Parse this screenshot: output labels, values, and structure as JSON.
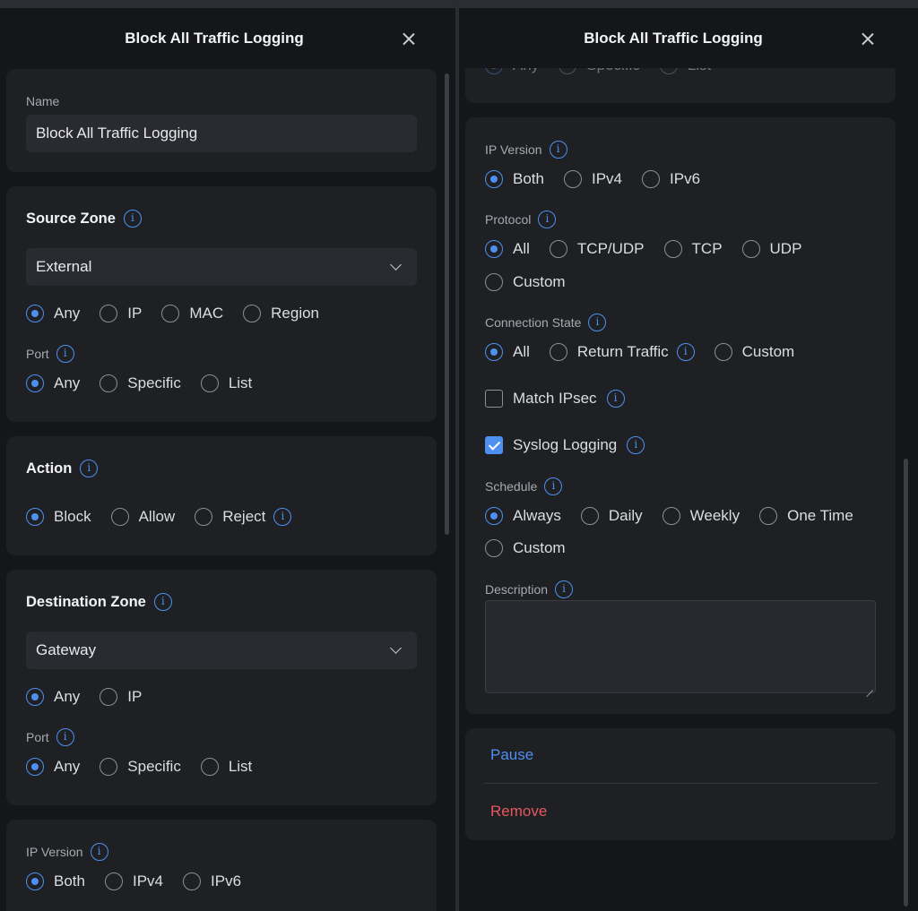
{
  "left": {
    "title": "Block All Traffic Logging",
    "name": {
      "label": "Name",
      "value": "Block All Traffic Logging"
    },
    "source_zone": {
      "title": "Source Zone",
      "selected": "External",
      "addr_options": [
        "Any",
        "IP",
        "MAC",
        "Region"
      ],
      "port_label": "Port",
      "port_options": [
        "Any",
        "Specific",
        "List"
      ]
    },
    "action": {
      "title": "Action",
      "options": [
        "Block",
        "Allow",
        "Reject"
      ]
    },
    "destination_zone": {
      "title": "Destination Zone",
      "selected": "Gateway",
      "addr_options": [
        "Any",
        "IP"
      ],
      "port_label": "Port",
      "port_options": [
        "Any",
        "Specific",
        "List"
      ]
    },
    "ip_version": {
      "label": "IP Version",
      "options": [
        "Both",
        "IPv4",
        "IPv6"
      ]
    }
  },
  "right": {
    "title": "Block All Traffic Logging",
    "partial_options": [
      "Any",
      "Specific",
      "List"
    ],
    "ip_version": {
      "label": "IP Version",
      "options": [
        "Both",
        "IPv4",
        "IPv6"
      ]
    },
    "protocol": {
      "label": "Protocol",
      "options": [
        "All",
        "TCP/UDP",
        "TCP",
        "UDP",
        "Custom"
      ]
    },
    "connection_state": {
      "label": "Connection State",
      "options": [
        "All",
        "Return Traffic",
        "Custom"
      ]
    },
    "match_ipsec": {
      "label": "Match IPsec",
      "checked": false
    },
    "syslog": {
      "label": "Syslog Logging",
      "checked": true
    },
    "schedule": {
      "label": "Schedule",
      "options": [
        "Always",
        "Daily",
        "Weekly",
        "One Time",
        "Custom"
      ]
    },
    "description": {
      "label": "Description",
      "value": ""
    },
    "pause_label": "Pause",
    "remove_label": "Remove"
  },
  "colors": {
    "accent": "#4d90f0",
    "danger": "#e5595d",
    "card": "#1f2024",
    "background": "#151619"
  },
  "icons": [
    "close-icon",
    "info-icon",
    "chevron-down-icon",
    "checkmark-icon"
  ]
}
